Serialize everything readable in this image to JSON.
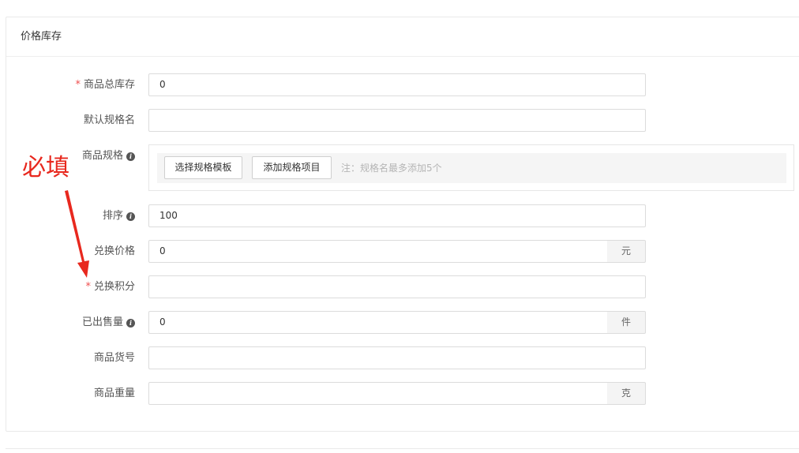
{
  "section": {
    "title": "价格库存"
  },
  "fields": {
    "total_stock": {
      "label": "商品总库存",
      "required_mark": "*",
      "value": "0"
    },
    "default_spec_name": {
      "label": "默认规格名",
      "value": ""
    },
    "spec": {
      "label": "商品规格",
      "info_icon": "i",
      "select_template_button": "选择规格模板",
      "add_item_button": "添加规格项目",
      "note": "注：规格名最多添加5个"
    },
    "sort": {
      "label": "排序",
      "info_icon": "i",
      "value": "100"
    },
    "exchange_price": {
      "label": "兑换价格",
      "value": "0",
      "unit": "元"
    },
    "exchange_points": {
      "label": "兑换积分",
      "required_mark": "*",
      "value": ""
    },
    "sold_count": {
      "label": "已出售量",
      "info_icon": "i",
      "value": "0",
      "unit": "件"
    },
    "product_code": {
      "label": "商品货号",
      "value": ""
    },
    "weight": {
      "label": "商品重量",
      "value": "",
      "unit": "克"
    }
  },
  "annotation": {
    "text": "必填",
    "color": "#e8281e"
  },
  "colors": {
    "required": "#ef4f4f",
    "border": "#dcdcdc",
    "addon_bg": "#f4f4f4"
  }
}
